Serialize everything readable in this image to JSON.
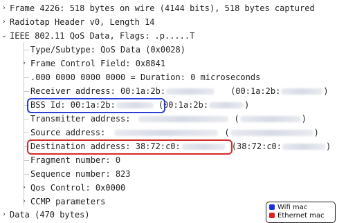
{
  "tree": {
    "frame": "Frame 4226: 518 bytes on wire (4144 bits), 518 bytes captured",
    "radiotap": "Radiotap Header v0, Length 14",
    "ieee": "IEEE 802.11 QoS Data, Flags: .p.....T",
    "type_subtype": "Type/Subtype: QoS Data (0x0028)",
    "frame_control": "Frame Control Field: 0x8841",
    "duration": ".000 0000 0000 0000 = Duration: 0 microseconds",
    "receiver_prefix": "Receiver address: 00:1a:2b:",
    "receiver_paren_open": "(00:1a:2b:",
    "receiver_paren_close": ")",
    "bss_prefix": "BSS Id: 00:1a:2b:",
    "bss_paren_open": "(00:1a:2b:",
    "bss_paren_close": ")",
    "transmitter_prefix": "Transmitter address:",
    "transmitter_paren_open": "(",
    "transmitter_paren_close": ")",
    "source_prefix": "Source address:",
    "source_paren_open": "(",
    "source_paren_close": ")",
    "destination_prefix": "Destination address: 38:72:c0:",
    "destination_paren_open": "(38:72:c0:",
    "destination_paren_close": ")",
    "fragment": "Fragment number: 0",
    "sequence": "Sequence number: 823",
    "qos_control": "Qos Control: 0x0000",
    "ccmp": "CCMP parameters",
    "data_row": "Data (470 bytes)"
  },
  "legend": {
    "wifi_label": "Wifi mac",
    "wifi_color": "#1f2fe0",
    "ethernet_label": "Ethernet mac",
    "ethernet_color": "#e01f1f"
  },
  "icons": {
    "collapsed": "chevron-right-icon",
    "expanded": "chevron-down-icon"
  }
}
